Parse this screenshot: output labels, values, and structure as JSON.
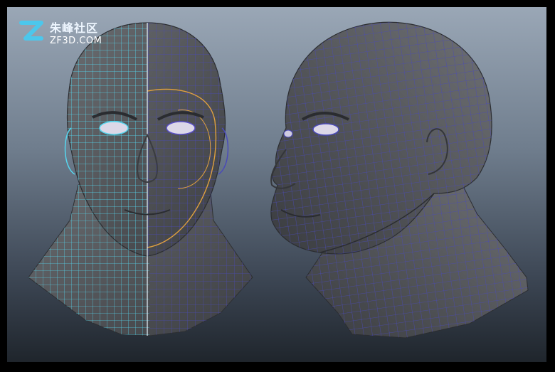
{
  "watermark": {
    "title": "朱峰社区",
    "site": "ZF3D.COM",
    "mark_color": "#4cc7ec"
  },
  "viewport": {
    "background_top": "#9aa7b6",
    "background_bottom": "#1f252c",
    "border_color": "#000000"
  },
  "models": [
    {
      "name": "head-front-view",
      "view": "front",
      "wire_left_color": "#55d7f0",
      "wire_right_color": "#5a4fc8",
      "accent_loop_color": "#e0a040"
    },
    {
      "name": "head-three-quarter-view",
      "view": "three-quarter",
      "wire_color": "#4a4ab8"
    }
  ],
  "mesh_color": "#5d5f63"
}
